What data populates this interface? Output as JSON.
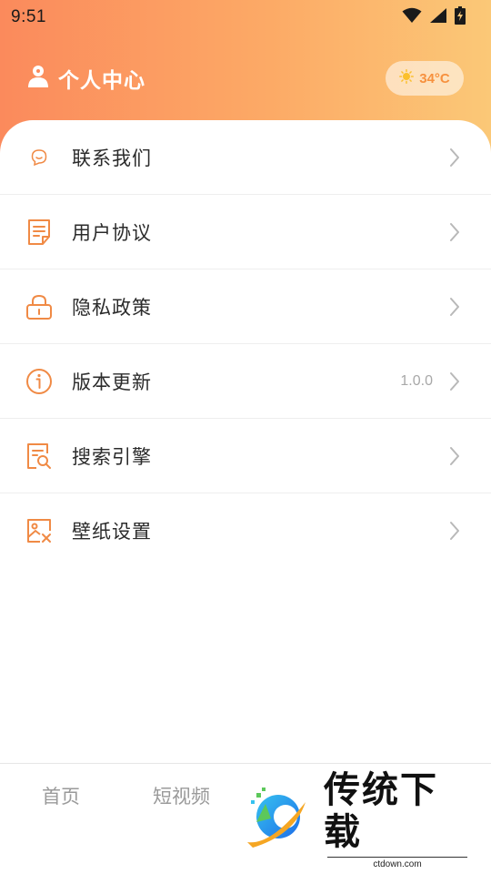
{
  "status_bar": {
    "time": "9:51",
    "icons": [
      "wifi-icon",
      "signal-icon",
      "battery-charging-icon"
    ]
  },
  "header": {
    "title": "个人中心",
    "icon": "user-icon",
    "weather": {
      "icon": "sun-icon",
      "temperature": "34°C"
    }
  },
  "colors": {
    "gradient_start": "#fb8a5c",
    "gradient_end": "#fbc877",
    "accent": "#f08a45",
    "text_primary": "#2b2b2b",
    "text_secondary": "#9a9a9a"
  },
  "menu": {
    "items": [
      {
        "label": "联系我们",
        "icon": "chat-bubble-icon",
        "value": ""
      },
      {
        "label": "用户协议",
        "icon": "document-icon",
        "value": ""
      },
      {
        "label": "隐私政策",
        "icon": "lock-icon",
        "value": ""
      },
      {
        "label": "版本更新",
        "icon": "info-icon",
        "value": "1.0.0"
      },
      {
        "label": "搜索引擎",
        "icon": "search-document-icon",
        "value": ""
      },
      {
        "label": "壁纸设置",
        "icon": "image-settings-icon",
        "value": ""
      }
    ]
  },
  "bottom_nav": {
    "items": [
      {
        "label": "首页"
      },
      {
        "label": "短视频"
      }
    ]
  },
  "watermark": {
    "title": "传统下载",
    "subtitle": "ctdown.com"
  }
}
